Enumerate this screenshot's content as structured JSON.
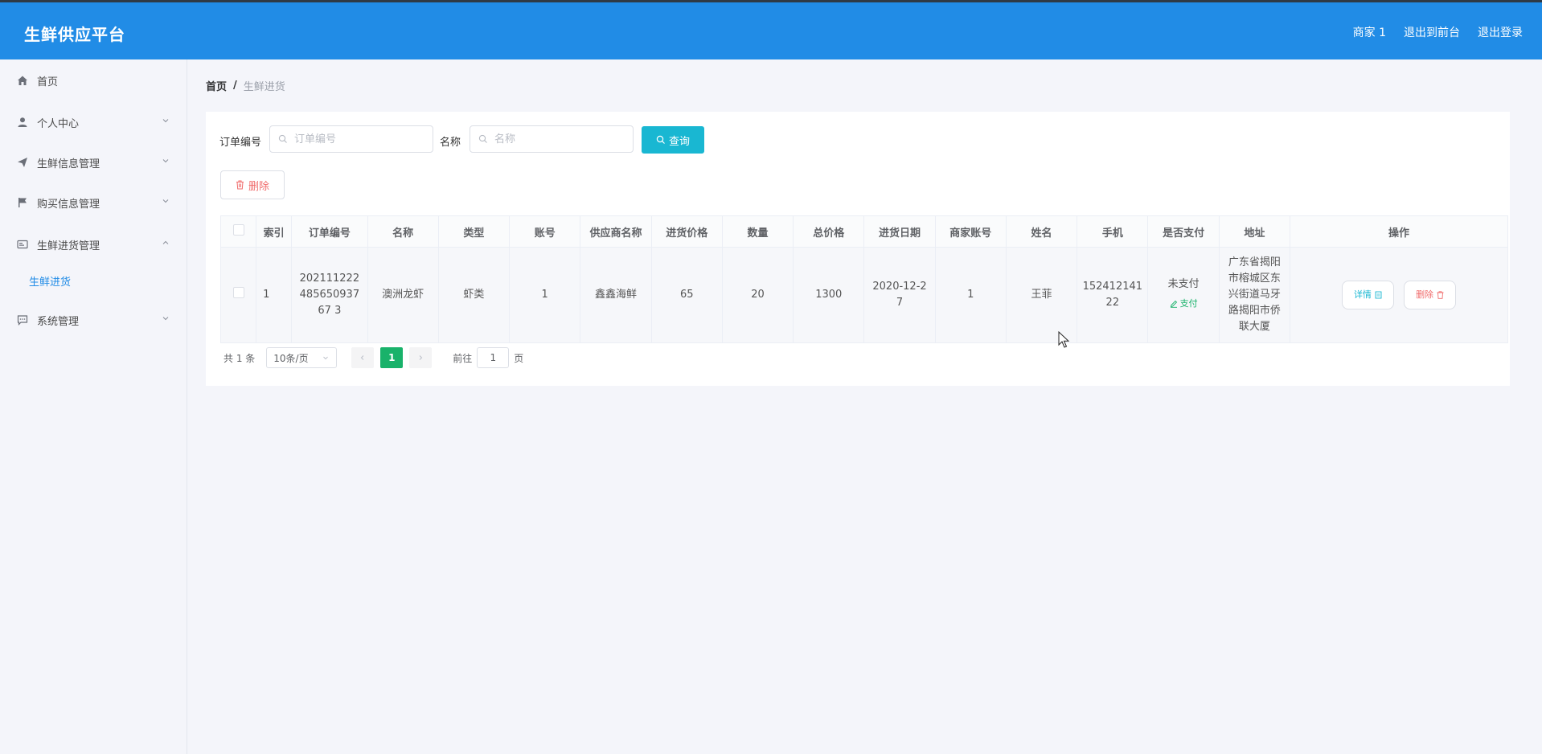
{
  "app": {
    "title": "生鲜供应平台",
    "merchant_label": "商家 1",
    "back_to_front": "退出到前台",
    "logout": "退出登录",
    "brand_color": "#218ce6"
  },
  "sidebar": {
    "items": [
      {
        "label": "首页",
        "icon": "home-icon",
        "expandable": false
      },
      {
        "label": "个人中心",
        "icon": "user-icon",
        "expandable": true,
        "expanded": false
      },
      {
        "label": "生鲜信息管理",
        "icon": "send-icon",
        "expandable": true,
        "expanded": false
      },
      {
        "label": "购买信息管理",
        "icon": "flag-icon",
        "expandable": true,
        "expanded": false
      },
      {
        "label": "生鲜进货管理",
        "icon": "card-icon",
        "expandable": true,
        "expanded": true
      },
      {
        "label": "系统管理",
        "icon": "chat-icon",
        "expandable": true,
        "expanded": false
      }
    ],
    "sub_items": [
      {
        "label": "生鲜进货",
        "active": true
      }
    ]
  },
  "breadcrumb": {
    "home": "首页",
    "separator": "/",
    "current": "生鲜进货"
  },
  "search": {
    "order_label": "订单编号",
    "order_placeholder": "订单编号",
    "name_label": "名称",
    "name_placeholder": "名称",
    "query_button": "查询"
  },
  "actions": {
    "delete_button": "删除"
  },
  "table": {
    "columns": [
      "索引",
      "订单编号",
      "名称",
      "类型",
      "账号",
      "供应商名称",
      "进货价格",
      "数量",
      "总价格",
      "进货日期",
      "商家账号",
      "姓名",
      "手机",
      "是否支付",
      "地址",
      "操作"
    ],
    "rows": [
      {
        "index": "1",
        "order_no": "20211122248565093767 3",
        "name": "澳洲龙虾",
        "type": "虾类",
        "account": "1",
        "supplier": "鑫鑫海鲜",
        "price": "65",
        "quantity": "20",
        "total": "1300",
        "date": "2020-12-2 7",
        "merchant_account": "1",
        "person_name": "王菲",
        "phone": "152412141 22",
        "pay_status": "未支付",
        "pay_action": "支付",
        "address": "广东省揭阳市榕城区东兴街道马牙路揭阳市侨联大厦",
        "detail_button": "详情",
        "delete_button": "删除"
      }
    ]
  },
  "pagination": {
    "total_text": "共 1 条",
    "page_size": "10条/页",
    "current_page": "1",
    "goto_label": "前往",
    "goto_value": "1",
    "page_suffix": "页"
  }
}
